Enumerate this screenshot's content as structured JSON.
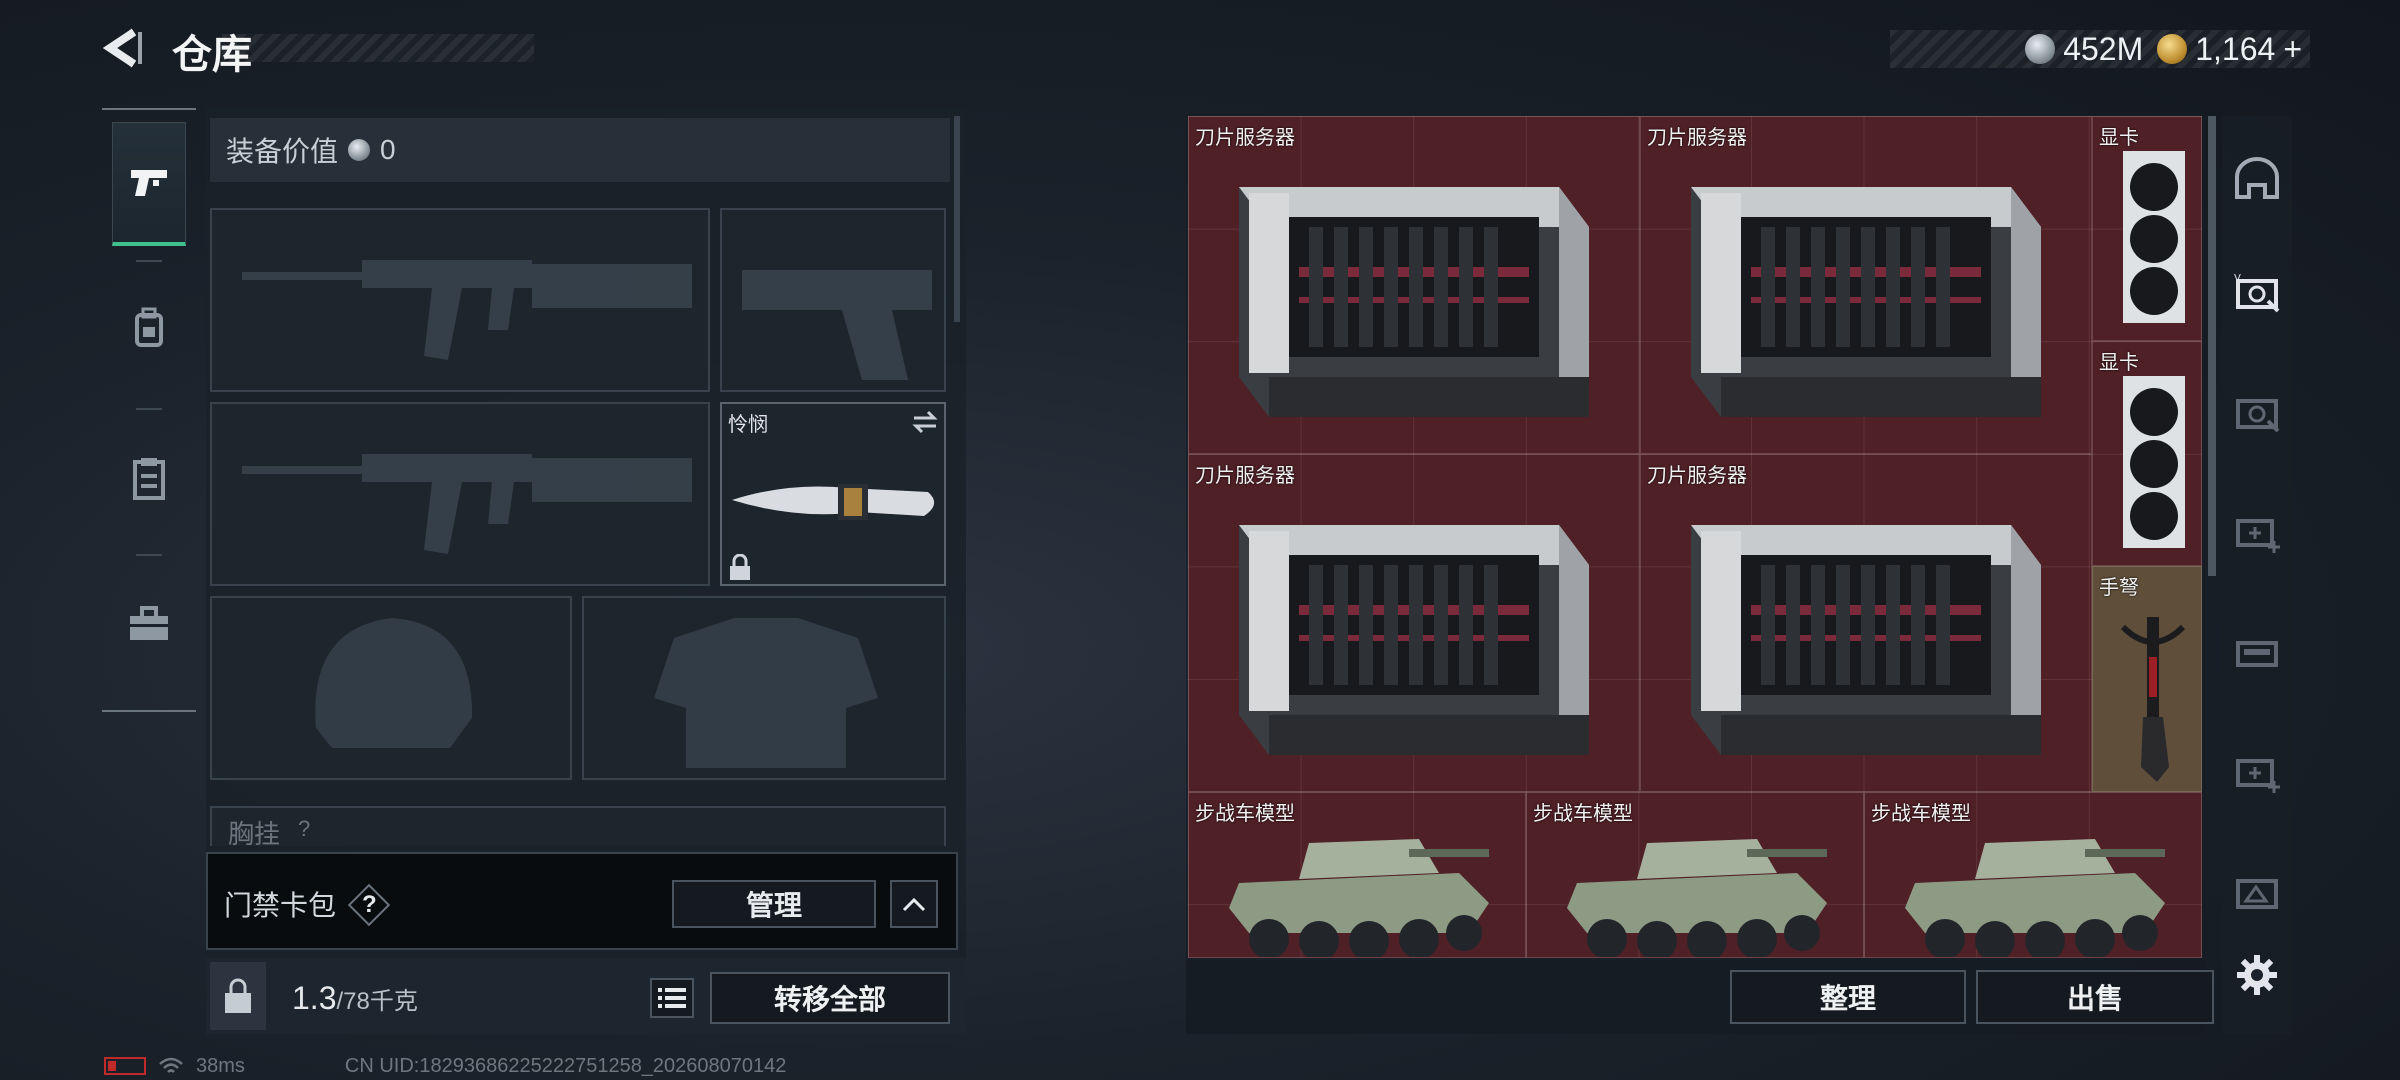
{
  "header": {
    "title": "仓库",
    "back_icon": "back-arrow-icon",
    "currency": [
      {
        "icon": "silver-coin-icon",
        "value": "452M"
      },
      {
        "icon": "gold-coin-icon",
        "value": "1,164",
        "suffix": "+"
      }
    ]
  },
  "left_rail": {
    "items": [
      {
        "icon": "pistol-icon",
        "active": true
      },
      {
        "icon": "backpack-icon",
        "active": false
      },
      {
        "icon": "clipboard-icon",
        "active": false
      },
      {
        "icon": "toolbox-icon",
        "active": false
      }
    ]
  },
  "equipment": {
    "value_label": "装备价值",
    "value": "0",
    "slots": [
      {
        "name": "primary-weapon-1",
        "icon": "rifle-icon",
        "empty": true
      },
      {
        "name": "sidearm",
        "icon": "pistol-silhouette-icon",
        "empty": true
      },
      {
        "name": "primary-weapon-2",
        "icon": "rifle-icon",
        "empty": true
      },
      {
        "name": "melee",
        "label": "怜悯",
        "icon": "knife-icon",
        "locked": true,
        "empty": false
      },
      {
        "name": "helmet",
        "icon": "helmet-icon",
        "empty": true
      },
      {
        "name": "armor",
        "icon": "vest-icon",
        "empty": true
      }
    ],
    "partial_label": "胸挂",
    "partial_help": "?",
    "card_pack": {
      "label": "门禁卡包",
      "help": "?",
      "manage_label": "管理"
    },
    "weight": {
      "value": "1.3",
      "max": "/78千克"
    },
    "transfer_all_label": "转移全部"
  },
  "stash": {
    "items": [
      {
        "label": "刀片服务器",
        "type": "server"
      },
      {
        "label": "刀片服务器",
        "type": "server"
      },
      {
        "label": "显卡",
        "type": "gpu"
      },
      {
        "label": "显卡",
        "type": "gpu"
      },
      {
        "label": "刀片服务器",
        "type": "server"
      },
      {
        "label": "刀片服务器",
        "type": "server"
      },
      {
        "label": "手弩",
        "type": "crossbow"
      },
      {
        "label": "步战车模型",
        "type": "ifv"
      },
      {
        "label": "步战车模型",
        "type": "ifv"
      },
      {
        "label": "步战车模型",
        "type": "ifv"
      }
    ],
    "sort_label": "整理",
    "sell_label": "出售"
  },
  "right_rail": {
    "icons": [
      "helmet-slot-icon",
      "grid-tool-icon",
      "grid-tool-iv-icon",
      "grid-add-iv-icon",
      "grid-iii-icon",
      "grid-add-iv-2-icon",
      "grid-iii-2-icon",
      "settings-gear-icon"
    ]
  },
  "status": {
    "ping": "38ms",
    "uid": "CN UID:18293686225222751258_202608070142"
  },
  "colors": {
    "accent_green": "#3fbf8c",
    "stash_red": "#4f2026",
    "battery_red": "#c02a2a"
  }
}
